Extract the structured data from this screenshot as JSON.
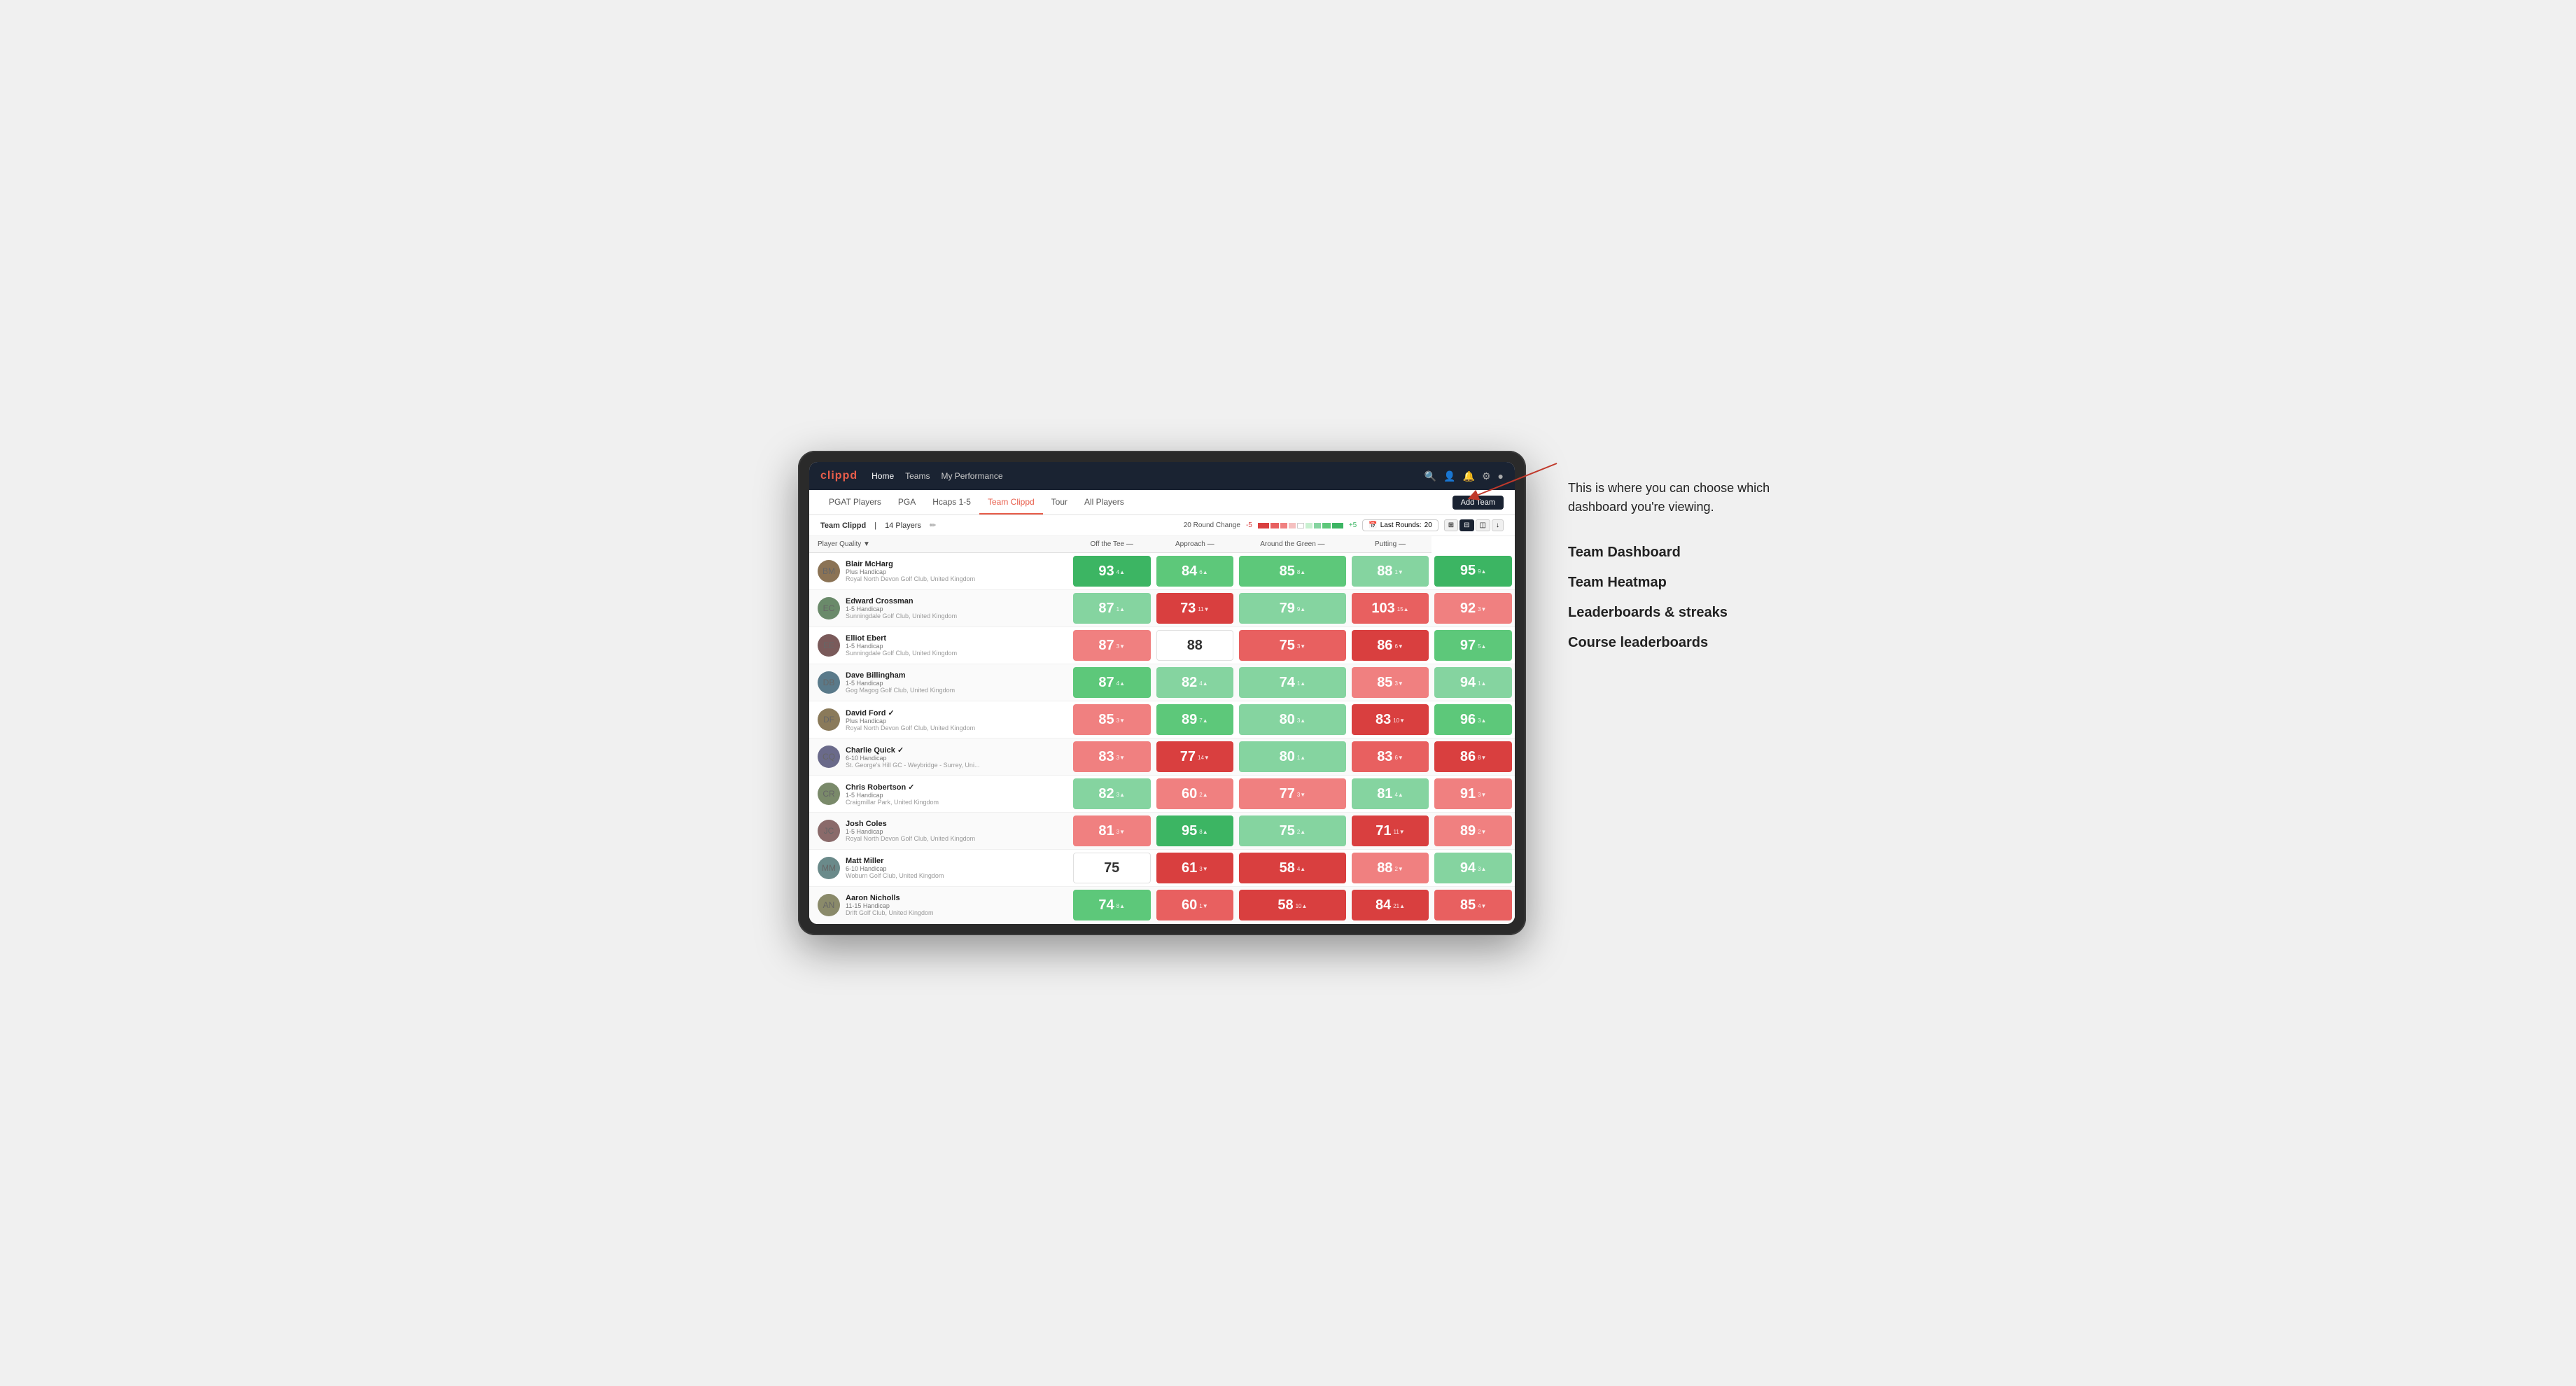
{
  "app": {
    "logo": "clippd",
    "nav_items": [
      "Home",
      "Teams",
      "My Performance"
    ],
    "active_nav": "Home"
  },
  "tabs": [
    "PGAT Players",
    "PGA",
    "Hcaps 1-5",
    "Team Clippd",
    "Tour",
    "All Players"
  ],
  "active_tab": "Team Clippd",
  "add_team_label": "Add Team",
  "team_bar": {
    "team_name": "Team Clippd",
    "separator": "|",
    "player_count": "14 Players",
    "edit_icon": "✏",
    "round_change_label": "20 Round Change",
    "range_low": "-5",
    "range_high": "+5",
    "last_rounds_label": "Last Rounds:",
    "last_rounds_value": "20"
  },
  "columns": {
    "player": "Player Quality ▼",
    "off_tee": "Off the Tee —",
    "approach": "Approach —",
    "around_green": "Around the Green —",
    "putting": "Putting —"
  },
  "players": [
    {
      "name": "Blair McHarg",
      "handicap": "Plus Handicap",
      "club": "Royal North Devon Golf Club, United Kingdom",
      "av_class": "av-1",
      "initials": "BM",
      "scores": {
        "quality": {
          "value": "93",
          "change": "4",
          "dir": "up",
          "bg": "bg-green-dark"
        },
        "off_tee": {
          "value": "84",
          "change": "6",
          "dir": "up",
          "bg": "bg-green-mid"
        },
        "approach": {
          "value": "85",
          "change": "8",
          "dir": "up",
          "bg": "bg-green-mid"
        },
        "around_green": {
          "value": "88",
          "change": "1",
          "dir": "down",
          "bg": "bg-green-light"
        },
        "putting": {
          "value": "95",
          "change": "9",
          "dir": "up",
          "bg": "bg-green-dark"
        }
      }
    },
    {
      "name": "Edward Crossman",
      "handicap": "1-5 Handicap",
      "club": "Sunningdale Golf Club, United Kingdom",
      "av_class": "av-2",
      "initials": "EC",
      "scores": {
        "quality": {
          "value": "87",
          "change": "1",
          "dir": "up",
          "bg": "bg-green-light"
        },
        "off_tee": {
          "value": "73",
          "change": "11",
          "dir": "down",
          "bg": "bg-red-dark"
        },
        "approach": {
          "value": "79",
          "change": "9",
          "dir": "up",
          "bg": "bg-green-light"
        },
        "around_green": {
          "value": "103",
          "change": "15",
          "dir": "up",
          "bg": "bg-red-mid"
        },
        "putting": {
          "value": "92",
          "change": "3",
          "dir": "down",
          "bg": "bg-red-light"
        }
      }
    },
    {
      "name": "Elliot Ebert",
      "handicap": "1-5 Handicap",
      "club": "Sunningdale Golf Club, United Kingdom",
      "av_class": "av-3",
      "initials": "EE",
      "scores": {
        "quality": {
          "value": "87",
          "change": "3",
          "dir": "down",
          "bg": "bg-red-light"
        },
        "off_tee": {
          "value": "88",
          "change": "",
          "dir": "",
          "bg": "bg-white"
        },
        "approach": {
          "value": "75",
          "change": "3",
          "dir": "down",
          "bg": "bg-red-mid"
        },
        "around_green": {
          "value": "86",
          "change": "6",
          "dir": "down",
          "bg": "bg-red-dark"
        },
        "putting": {
          "value": "97",
          "change": "5",
          "dir": "up",
          "bg": "bg-green-mid"
        }
      }
    },
    {
      "name": "Dave Billingham",
      "handicap": "1-5 Handicap",
      "club": "Gog Magog Golf Club, United Kingdom",
      "av_class": "av-4",
      "initials": "DB",
      "scores": {
        "quality": {
          "value": "87",
          "change": "4",
          "dir": "up",
          "bg": "bg-green-mid"
        },
        "off_tee": {
          "value": "82",
          "change": "4",
          "dir": "up",
          "bg": "bg-green-light"
        },
        "approach": {
          "value": "74",
          "change": "1",
          "dir": "up",
          "bg": "bg-green-light"
        },
        "around_green": {
          "value": "85",
          "change": "3",
          "dir": "down",
          "bg": "bg-red-light"
        },
        "putting": {
          "value": "94",
          "change": "1",
          "dir": "up",
          "bg": "bg-green-light"
        }
      }
    },
    {
      "name": "David Ford",
      "handicap": "Plus Handicap",
      "club": "Royal North Devon Golf Club, United Kingdom",
      "av_class": "av-5",
      "initials": "DF",
      "verified": true,
      "scores": {
        "quality": {
          "value": "85",
          "change": "3",
          "dir": "down",
          "bg": "bg-red-light"
        },
        "off_tee": {
          "value": "89",
          "change": "7",
          "dir": "up",
          "bg": "bg-green-mid"
        },
        "approach": {
          "value": "80",
          "change": "3",
          "dir": "up",
          "bg": "bg-green-light"
        },
        "around_green": {
          "value": "83",
          "change": "10",
          "dir": "down",
          "bg": "bg-red-dark"
        },
        "putting": {
          "value": "96",
          "change": "3",
          "dir": "up",
          "bg": "bg-green-mid"
        }
      }
    },
    {
      "name": "Charlie Quick",
      "handicap": "6-10 Handicap",
      "club": "St. George's Hill GC - Weybridge - Surrey, Uni...",
      "av_class": "av-6",
      "initials": "CQ",
      "verified": true,
      "scores": {
        "quality": {
          "value": "83",
          "change": "3",
          "dir": "down",
          "bg": "bg-red-light"
        },
        "off_tee": {
          "value": "77",
          "change": "14",
          "dir": "down",
          "bg": "bg-red-dark"
        },
        "approach": {
          "value": "80",
          "change": "1",
          "dir": "up",
          "bg": "bg-green-light"
        },
        "around_green": {
          "value": "83",
          "change": "6",
          "dir": "down",
          "bg": "bg-red-mid"
        },
        "putting": {
          "value": "86",
          "change": "8",
          "dir": "down",
          "bg": "bg-red-dark"
        }
      }
    },
    {
      "name": "Chris Robertson",
      "handicap": "1-5 Handicap",
      "club": "Craigmillar Park, United Kingdom",
      "av_class": "av-7",
      "initials": "CR",
      "verified": true,
      "scores": {
        "quality": {
          "value": "82",
          "change": "3",
          "dir": "up",
          "bg": "bg-green-light"
        },
        "off_tee": {
          "value": "60",
          "change": "2",
          "dir": "up",
          "bg": "bg-red-light"
        },
        "approach": {
          "value": "77",
          "change": "3",
          "dir": "down",
          "bg": "bg-red-light"
        },
        "around_green": {
          "value": "81",
          "change": "4",
          "dir": "up",
          "bg": "bg-green-light"
        },
        "putting": {
          "value": "91",
          "change": "3",
          "dir": "down",
          "bg": "bg-red-light"
        }
      }
    },
    {
      "name": "Josh Coles",
      "handicap": "1-5 Handicap",
      "club": "Royal North Devon Golf Club, United Kingdom",
      "av_class": "av-8",
      "initials": "JC",
      "scores": {
        "quality": {
          "value": "81",
          "change": "3",
          "dir": "down",
          "bg": "bg-red-light"
        },
        "off_tee": {
          "value": "95",
          "change": "8",
          "dir": "up",
          "bg": "bg-green-dark"
        },
        "approach": {
          "value": "75",
          "change": "2",
          "dir": "up",
          "bg": "bg-green-light"
        },
        "around_green": {
          "value": "71",
          "change": "11",
          "dir": "down",
          "bg": "bg-red-dark"
        },
        "putting": {
          "value": "89",
          "change": "2",
          "dir": "down",
          "bg": "bg-red-light"
        }
      }
    },
    {
      "name": "Matt Miller",
      "handicap": "6-10 Handicap",
      "club": "Woburn Golf Club, United Kingdom",
      "av_class": "av-9",
      "initials": "MM",
      "scores": {
        "quality": {
          "value": "75",
          "change": "",
          "dir": "",
          "bg": "bg-white"
        },
        "off_tee": {
          "value": "61",
          "change": "3",
          "dir": "down",
          "bg": "bg-red-dark"
        },
        "approach": {
          "value": "58",
          "change": "4",
          "dir": "up",
          "bg": "bg-red-dark"
        },
        "around_green": {
          "value": "88",
          "change": "2",
          "dir": "down",
          "bg": "bg-red-light"
        },
        "putting": {
          "value": "94",
          "change": "3",
          "dir": "up",
          "bg": "bg-green-light"
        }
      }
    },
    {
      "name": "Aaron Nicholls",
      "handicap": "11-15 Handicap",
      "club": "Drift Golf Club, United Kingdom",
      "av_class": "av-10",
      "initials": "AN",
      "scores": {
        "quality": {
          "value": "74",
          "change": "8",
          "dir": "up",
          "bg": "bg-green-mid"
        },
        "off_tee": {
          "value": "60",
          "change": "1",
          "dir": "down",
          "bg": "bg-red-mid"
        },
        "approach": {
          "value": "58",
          "change": "10",
          "dir": "up",
          "bg": "bg-red-dark"
        },
        "around_green": {
          "value": "84",
          "change": "21",
          "dir": "up",
          "bg": "bg-red-dark"
        },
        "putting": {
          "value": "85",
          "change": "4",
          "dir": "down",
          "bg": "bg-red-mid"
        }
      }
    }
  ],
  "annotation": {
    "intro": "This is where you can choose which dashboard you're viewing.",
    "options": [
      "Team Dashboard",
      "Team Heatmap",
      "Leaderboards & streaks",
      "Course leaderboards"
    ]
  }
}
